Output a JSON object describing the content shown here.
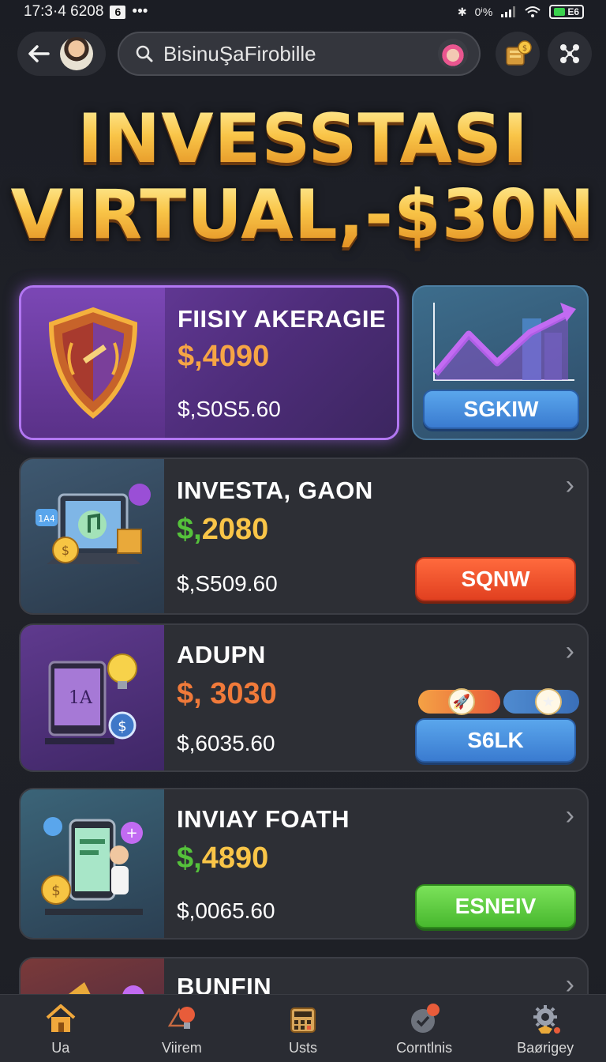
{
  "status_bar": {
    "time": "17:3·4 6208",
    "badge": "6",
    "dots": "•••",
    "signal_text": "0ⁱ%",
    "battery": "E6"
  },
  "top_bar": {
    "back_icon": "back-arrow-icon",
    "search": {
      "value": "BisinuŞaFirobille"
    }
  },
  "hero": {
    "line1": "INVESSTASI",
    "line2": "VIRTUAL,-$30N"
  },
  "featured": {
    "title": "FIISIY AKERAGIE",
    "price": "$,4090",
    "sub": "$,S0S5.60",
    "price_color": "#f6a545"
  },
  "chart_card": {
    "button_label": "SGKIW"
  },
  "cards": [
    {
      "title": "INVESTA, GAON",
      "price_prefix": "$,",
      "price_value": "2080",
      "sub": "$,S509.60",
      "button_label": "SQNW"
    },
    {
      "title": "ADUPN",
      "price": "$, 3030",
      "sub": "$,6035.60",
      "button_label": "S6LK"
    },
    {
      "title": "INVIAY FOATH",
      "price_prefix": "$,",
      "price_value": "4890",
      "sub": "$,0065.60",
      "button_label": "ESNEIV"
    },
    {
      "title": "BUNFIN"
    }
  ],
  "bottom_nav": [
    {
      "label": "Ua",
      "icon": "home-icon"
    },
    {
      "label": "Viirem",
      "icon": "lightbulb-icon"
    },
    {
      "label": "Usts",
      "icon": "calculator-icon"
    },
    {
      "label": "Corntlnis",
      "icon": "check-badge-icon"
    },
    {
      "label": "Baørigey",
      "icon": "gear-icon"
    }
  ],
  "colors": {
    "gold": "#f9c548",
    "green": "#55c23b",
    "orange": "#f07a3a",
    "purple_accent": "#b277f2"
  }
}
